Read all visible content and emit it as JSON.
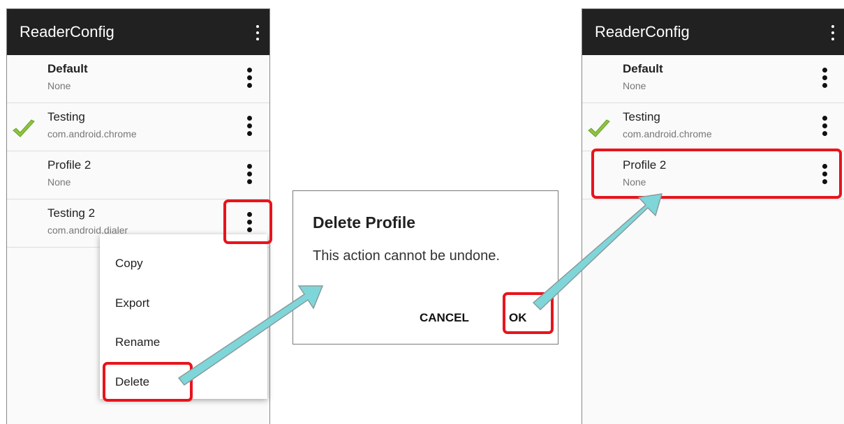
{
  "app_title": "ReaderConfig",
  "left_screen": {
    "profiles": [
      {
        "name": "Default",
        "package": "None",
        "bold": true
      },
      {
        "name": "Testing",
        "package": "com.android.chrome",
        "checked": true
      },
      {
        "name": "Profile 2",
        "package": "None"
      },
      {
        "name": "Testing 2",
        "package": "com.android.dialer"
      }
    ],
    "menu_items": [
      "Copy",
      "Export",
      "Rename",
      "Delete"
    ]
  },
  "dialog": {
    "title": "Delete Profile",
    "message": "This action cannot be undone.",
    "cancel_label": "CANCEL",
    "ok_label": "OK"
  },
  "right_screen": {
    "profiles": [
      {
        "name": "Default",
        "package": "None",
        "bold": true
      },
      {
        "name": "Testing",
        "package": "com.android.chrome",
        "checked": true
      },
      {
        "name": "Profile 2",
        "package": "None"
      }
    ]
  },
  "colors": {
    "appbar": "#212121",
    "highlight": "#e8141c",
    "arrow": "#7fd6d9",
    "checkmark": "#8cc63f"
  },
  "icons": [
    "overflow-menu-icon",
    "more-vert-icon",
    "checkmark-icon",
    "arrow-icon"
  ]
}
